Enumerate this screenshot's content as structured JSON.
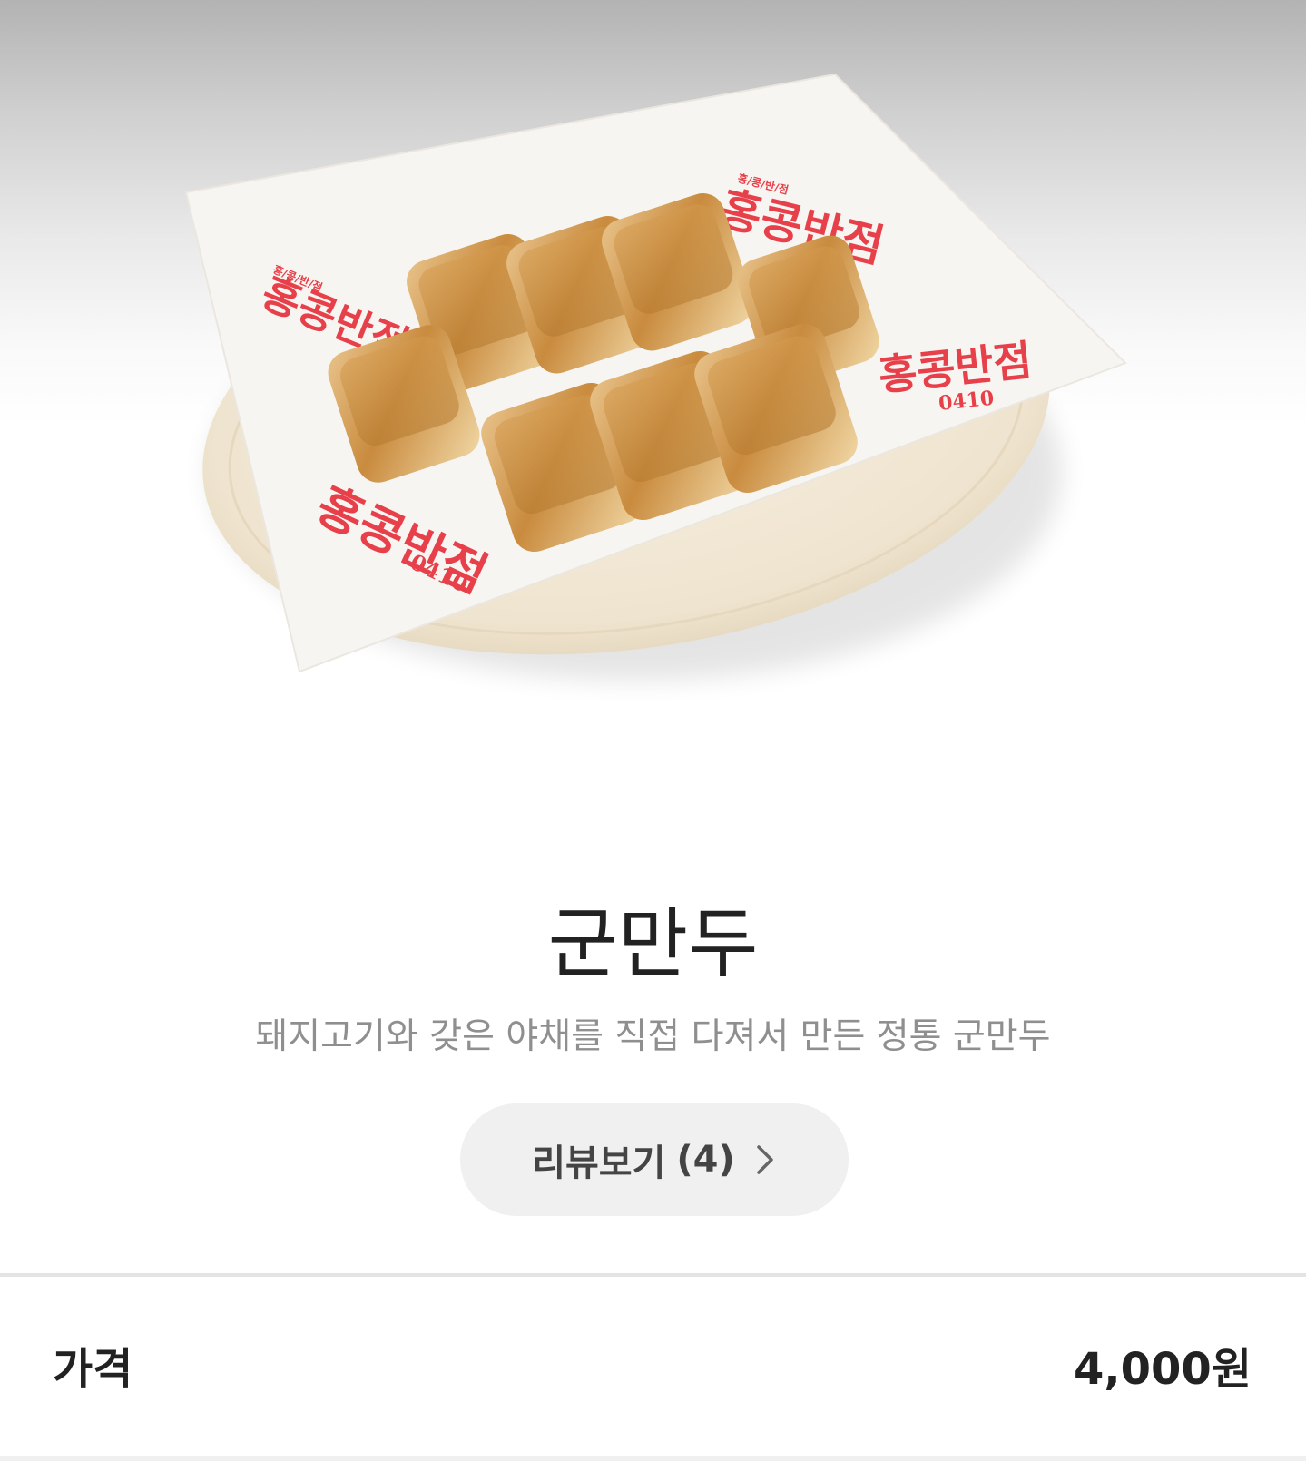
{
  "hero": {
    "image": "product-photo",
    "wrapper_brand": "홍콩반점",
    "wrapper_subtext": "0410",
    "wrapper_small": "홍/콩/반/점"
  },
  "menu": {
    "title": "군만두",
    "description": "돼지고기와 갖은 야채를 직접 다져서 만든 정통 군만두"
  },
  "review_button": {
    "label": "리뷰보기",
    "count": "(4)",
    "icon": "chevron-right-icon"
  },
  "price": {
    "label": "가격",
    "value": "4,000원"
  },
  "colors": {
    "title_text": "#222222",
    "desc_text": "#8f8f8f",
    "button_bg": "#f0f0f0",
    "button_text": "#444444",
    "divider": "#e4e4e4",
    "brand_red": "#e8404a"
  }
}
